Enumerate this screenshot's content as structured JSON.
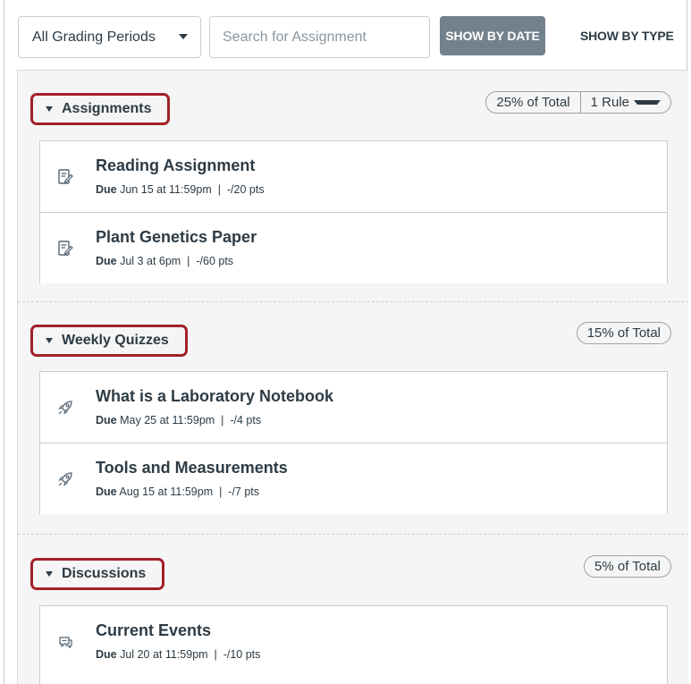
{
  "toolbar": {
    "grading_period": "All Grading Periods",
    "search_placeholder": "Search for Assignment",
    "show_by_date": "SHOW BY DATE",
    "show_by_type": "SHOW BY TYPE"
  },
  "groups": [
    {
      "name": "Assignments",
      "weight": "25% of Total",
      "rule": "1 Rule",
      "icon": "assignment-icon",
      "items": [
        {
          "title": "Reading Assignment",
          "due_label": "Due",
          "due": "Jun 15 at 11:59pm",
          "points": "-/20 pts"
        },
        {
          "title": "Plant Genetics Paper",
          "due_label": "Due",
          "due": "Jul 3 at 6pm",
          "points": "-/60 pts"
        }
      ]
    },
    {
      "name": "Weekly Quizzes",
      "weight": "15% of Total",
      "icon": "quiz-rocket-icon",
      "items": [
        {
          "title": "What is a Laboratory Notebook",
          "due_label": "Due",
          "due": "May 25 at 11:59pm",
          "points": "-/4 pts"
        },
        {
          "title": "Tools and Measurements",
          "due_label": "Due",
          "due": "Aug 15 at 11:59pm",
          "points": "-/7 pts"
        }
      ]
    },
    {
      "name": "Discussions",
      "weight": "5% of Total",
      "icon": "discussion-icon",
      "items": [
        {
          "title": "Current Events",
          "due_label": "Due",
          "due": "Jul 20 at 11:59pm",
          "points": "-/10 pts"
        }
      ]
    }
  ],
  "separator": "|",
  "colors": {
    "highlight_border": "#a32028",
    "button_bg": "#73818c",
    "text": "#2d3b45",
    "panel_bg": "#f5f5f5"
  }
}
